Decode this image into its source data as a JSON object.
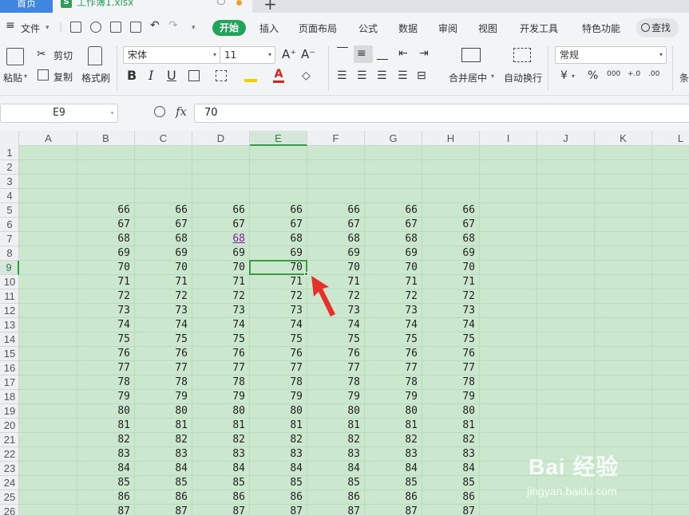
{
  "tabs": {
    "home": "首页",
    "file": "工作簿1.xlsx",
    "file_icon": "S",
    "plus": "+"
  },
  "menu": {
    "hamburger": "≡",
    "file": "文件",
    "start": "开始",
    "items": [
      "插入",
      "页面布局",
      "公式",
      "数据",
      "审阅",
      "视图",
      "开发工具",
      "特色功能"
    ],
    "search": "查找"
  },
  "ribbon": {
    "paste": "粘贴",
    "cut": "剪切",
    "copy": "复制",
    "format_painter": "格式刷",
    "font_name": "宋体",
    "font_size": "11",
    "grow": "A⁺",
    "shrink": "A⁻",
    "bold": "B",
    "italic": "I",
    "underline": "U",
    "merge": "合并居中",
    "wrap": "自动换行",
    "number_format": "常规",
    "currency": "¥",
    "percent": "%",
    "thousands": "000",
    "inc_decimal": "+.0",
    "dec_decimal": ".00",
    "cond": "条"
  },
  "formula_bar": {
    "name_box": "E9",
    "fx": "fx",
    "value": "70"
  },
  "sheet": {
    "columns": [
      "A",
      "B",
      "C",
      "D",
      "E",
      "F",
      "G",
      "H",
      "I",
      "J",
      "K",
      "L"
    ],
    "rows": [
      "1",
      "2",
      "3",
      "4",
      "5",
      "6",
      "7",
      "8",
      "9",
      "10",
      "11",
      "12",
      "13",
      "14",
      "15",
      "16",
      "17",
      "18",
      "19",
      "20",
      "21",
      "22",
      "23",
      "24",
      "25",
      "26"
    ],
    "active_col": "E",
    "active_row": "9",
    "data_rows": [
      [
        "66",
        "66",
        "66",
        "66",
        "66",
        "66",
        "66"
      ],
      [
        "67",
        "67",
        "67",
        "67",
        "67",
        "67",
        "67"
      ],
      [
        "68",
        "68",
        "68",
        "68",
        "68",
        "68",
        "68"
      ],
      [
        "69",
        "69",
        "69",
        "69",
        "69",
        "69",
        "69"
      ],
      [
        "70",
        "70",
        "70",
        "70",
        "70",
        "70",
        "70"
      ],
      [
        "71",
        "71",
        "71",
        "71",
        "71",
        "71",
        "71"
      ],
      [
        "72",
        "72",
        "72",
        "72",
        "72",
        "72",
        "72"
      ],
      [
        "73",
        "73",
        "73",
        "73",
        "73",
        "73",
        "73"
      ],
      [
        "74",
        "74",
        "74",
        "74",
        "74",
        "74",
        "74"
      ],
      [
        "75",
        "75",
        "75",
        "75",
        "75",
        "75",
        "75"
      ],
      [
        "76",
        "76",
        "76",
        "76",
        "76",
        "76",
        "76"
      ],
      [
        "77",
        "77",
        "77",
        "77",
        "77",
        "77",
        "77"
      ],
      [
        "78",
        "78",
        "78",
        "78",
        "78",
        "78",
        "78"
      ],
      [
        "79",
        "79",
        "79",
        "79",
        "79",
        "79",
        "79"
      ],
      [
        "80",
        "80",
        "80",
        "80",
        "80",
        "80",
        "80"
      ],
      [
        "81",
        "81",
        "81",
        "81",
        "81",
        "81",
        "81"
      ],
      [
        "82",
        "82",
        "82",
        "82",
        "82",
        "82",
        "82"
      ],
      [
        "83",
        "83",
        "83",
        "83",
        "83",
        "83",
        "83"
      ],
      [
        "84",
        "84",
        "84",
        "84",
        "84",
        "84",
        "84"
      ],
      [
        "85",
        "85",
        "85",
        "85",
        "85",
        "85",
        "85"
      ],
      [
        "86",
        "86",
        "86",
        "86",
        "86",
        "86",
        "86"
      ],
      [
        "87",
        "87",
        "87",
        "87",
        "87",
        "87",
        "87"
      ]
    ]
  },
  "watermark": {
    "brand": "Bai  经验",
    "url": "jingyan.baidu.com"
  },
  "colors": {
    "accent_green": "#22a45a",
    "sheet_bg": "#cbe8cf",
    "selection": "#3c9b46",
    "arrow": "#e8302a"
  }
}
